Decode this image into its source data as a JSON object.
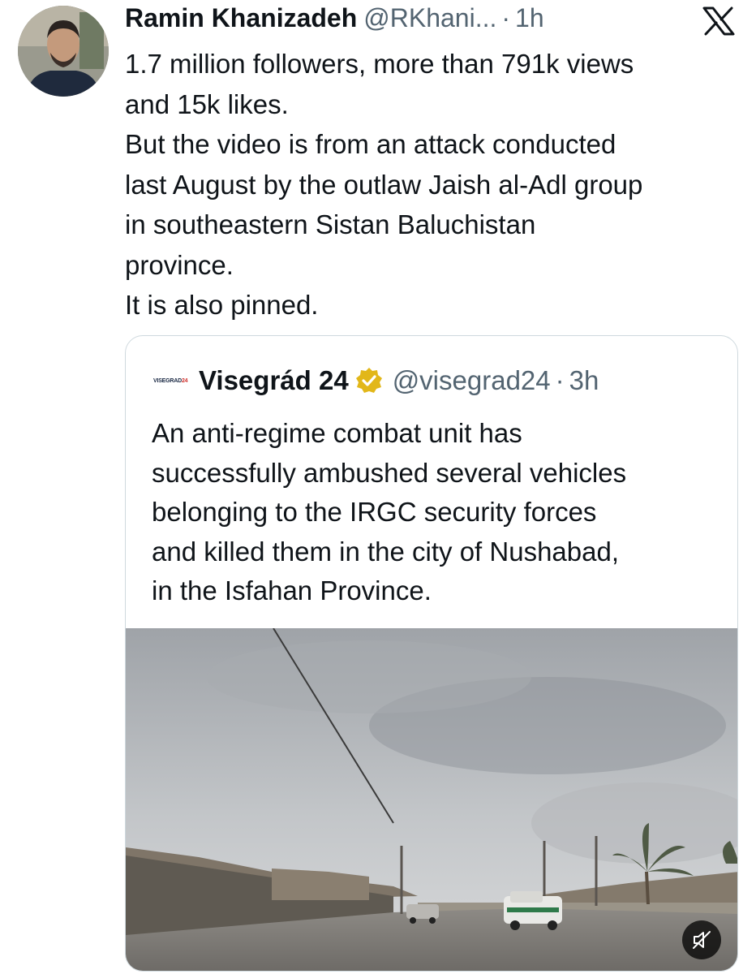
{
  "post": {
    "author_name": "Ramin Khanizadeh",
    "author_handle": "@RKhani...",
    "separator": "·",
    "time": "1h",
    "text": "1.7 million followers, more than 791k views\nand 15k likes.\nBut the video is from an attack conducted\nlast August by the outlaw Jaish al-Adl group\nin southeastern Sistan Baluchistan\nprovince.\nIt is also pinned."
  },
  "platform_icon": "x-logo-icon",
  "quoted_post": {
    "logo_text": "VISEGRAD",
    "logo_suffix": "24",
    "author_name": "Visegrád 24",
    "verified_badge": "gold-check-badge-icon",
    "author_handle": "@visegrad24",
    "separator": "·",
    "time": "3h",
    "text": "An anti-regime combat unit has\nsuccessfully ambushed several vehicles\nbelonging to the IRGC security forces\nand killed them in the city of Nushabad,\nin the Isfahan Province.",
    "media": {
      "type": "video-still",
      "mute_icon": "speaker-muted-icon"
    }
  },
  "colors": {
    "text": "#0f1419",
    "secondary_text": "#536471",
    "card_border": "#cfd9de",
    "badge_gold": "#e2b719"
  }
}
